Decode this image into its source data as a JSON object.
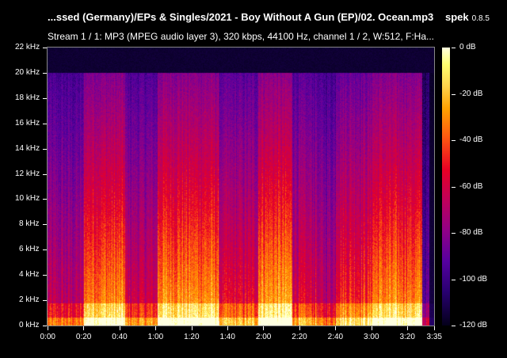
{
  "window": {
    "title": "...ssed (Germany)/EPs & Singles/2021 - Boy Without A Gun (EP)/02. Ocean.mp3",
    "app_name": "spek",
    "app_version": "0.8.5",
    "stream_info": "Stream 1 / 1: MP3 (MPEG audio layer 3), 320 kbps, 44100 Hz, channel 1 / 2, W:512, F:Ha..."
  },
  "spectrogram": {
    "y_ticks": [
      "22 kHz",
      "20 kHz",
      "18 kHz",
      "16 kHz",
      "14 kHz",
      "12 kHz",
      "10 kHz",
      "8 kHz",
      "6 kHz",
      "4 kHz",
      "2 kHz",
      "0 kHz"
    ],
    "x_ticks": [
      "0:00",
      "0:20",
      "0:40",
      "1:00",
      "1:20",
      "1:40",
      "2:00",
      "2:20",
      "2:40",
      "3:00",
      "3:20",
      "3:35"
    ],
    "colorbar_ticks": [
      "0 dB",
      "-20 dB",
      "-40 dB",
      "-60 dB",
      "-80 dB",
      "-100 dB",
      "-120 dB"
    ],
    "duration_seconds": 215,
    "max_frequency_khz": 22,
    "cutoff_frequency_khz": 20,
    "db_range": [
      -120,
      0
    ]
  }
}
